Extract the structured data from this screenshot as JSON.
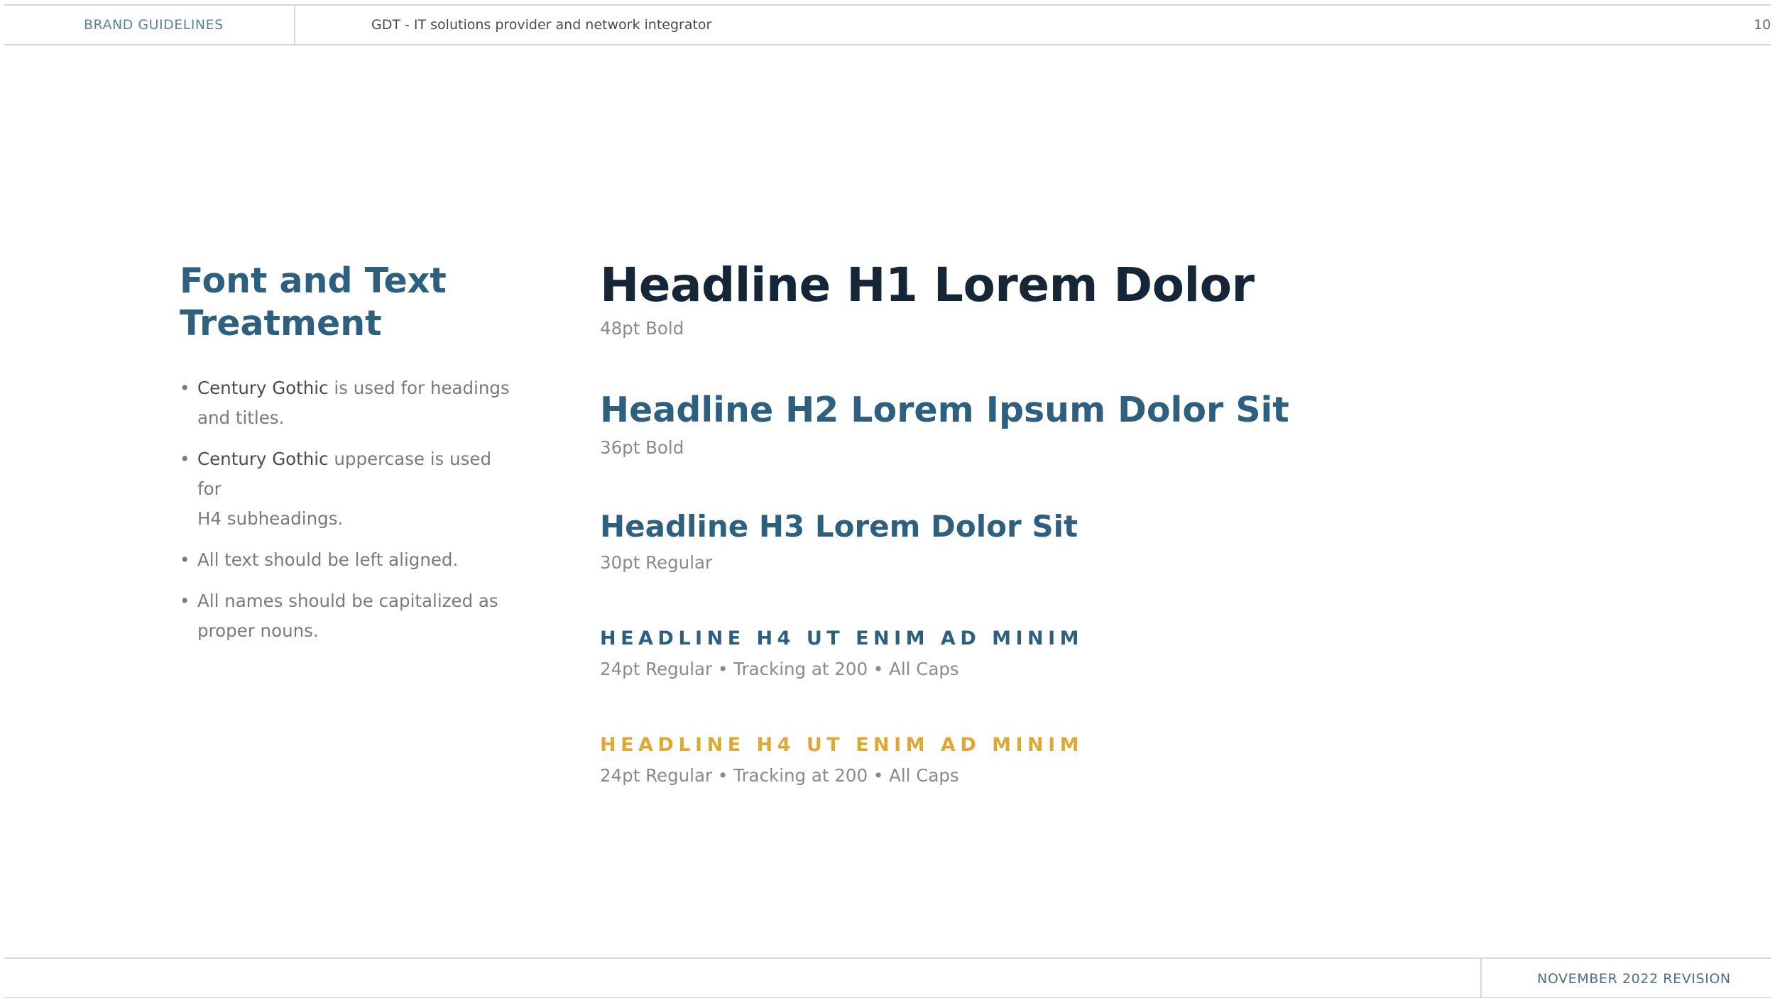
{
  "header": {
    "brand_label": "BRAND GUIDELINES",
    "doc_title": "GDT - IT solutions provider and network integrator",
    "page_number": "10"
  },
  "footer": {
    "revision": "NOVEMBER 2022 REVISION"
  },
  "left": {
    "title_line1": "Font and Text",
    "title_line2": "Treatment",
    "bullet_symbol": "•",
    "bullets": [
      {
        "strong": "Century Gothic",
        "text_line1": " is used for headings",
        "text_line2": "and titles."
      },
      {
        "strong": "Century Gothic",
        "text_line1": " uppercase is used for",
        "text_line2": "H4 subheadings."
      },
      {
        "strong": "",
        "text_line1": "All text should be left aligned.",
        "text_line2": ""
      },
      {
        "strong": "",
        "text_line1": "All names should be capitalized as",
        "text_line2": "proper nouns."
      }
    ]
  },
  "samples": {
    "h1": {
      "text": "Headline H1 Lorem Dolor",
      "note": "48pt Bold"
    },
    "h2": {
      "text": "Headline H2 Lorem Ipsum Dolor Sit",
      "note": "36pt Bold"
    },
    "h3": {
      "text": "Headline H3 Lorem Dolor Sit",
      "note": "30pt Regular"
    },
    "h4_blue": {
      "text": "HEADLINE H4 UT ENIM AD MINIM",
      "note": "24pt Regular • Tracking at 200 • All Caps"
    },
    "h4_gold": {
      "text": "HEADLINE H4 UT ENIM AD MINIM",
      "note": "24pt Regular • Tracking at 200 • All Caps"
    }
  },
  "colors": {
    "primary_blue": "#2d5f7e",
    "dark_navy": "#152737",
    "gold": "#dea835",
    "body_gray": "#7a7a7a",
    "rule_gray": "#d6d6d6"
  }
}
